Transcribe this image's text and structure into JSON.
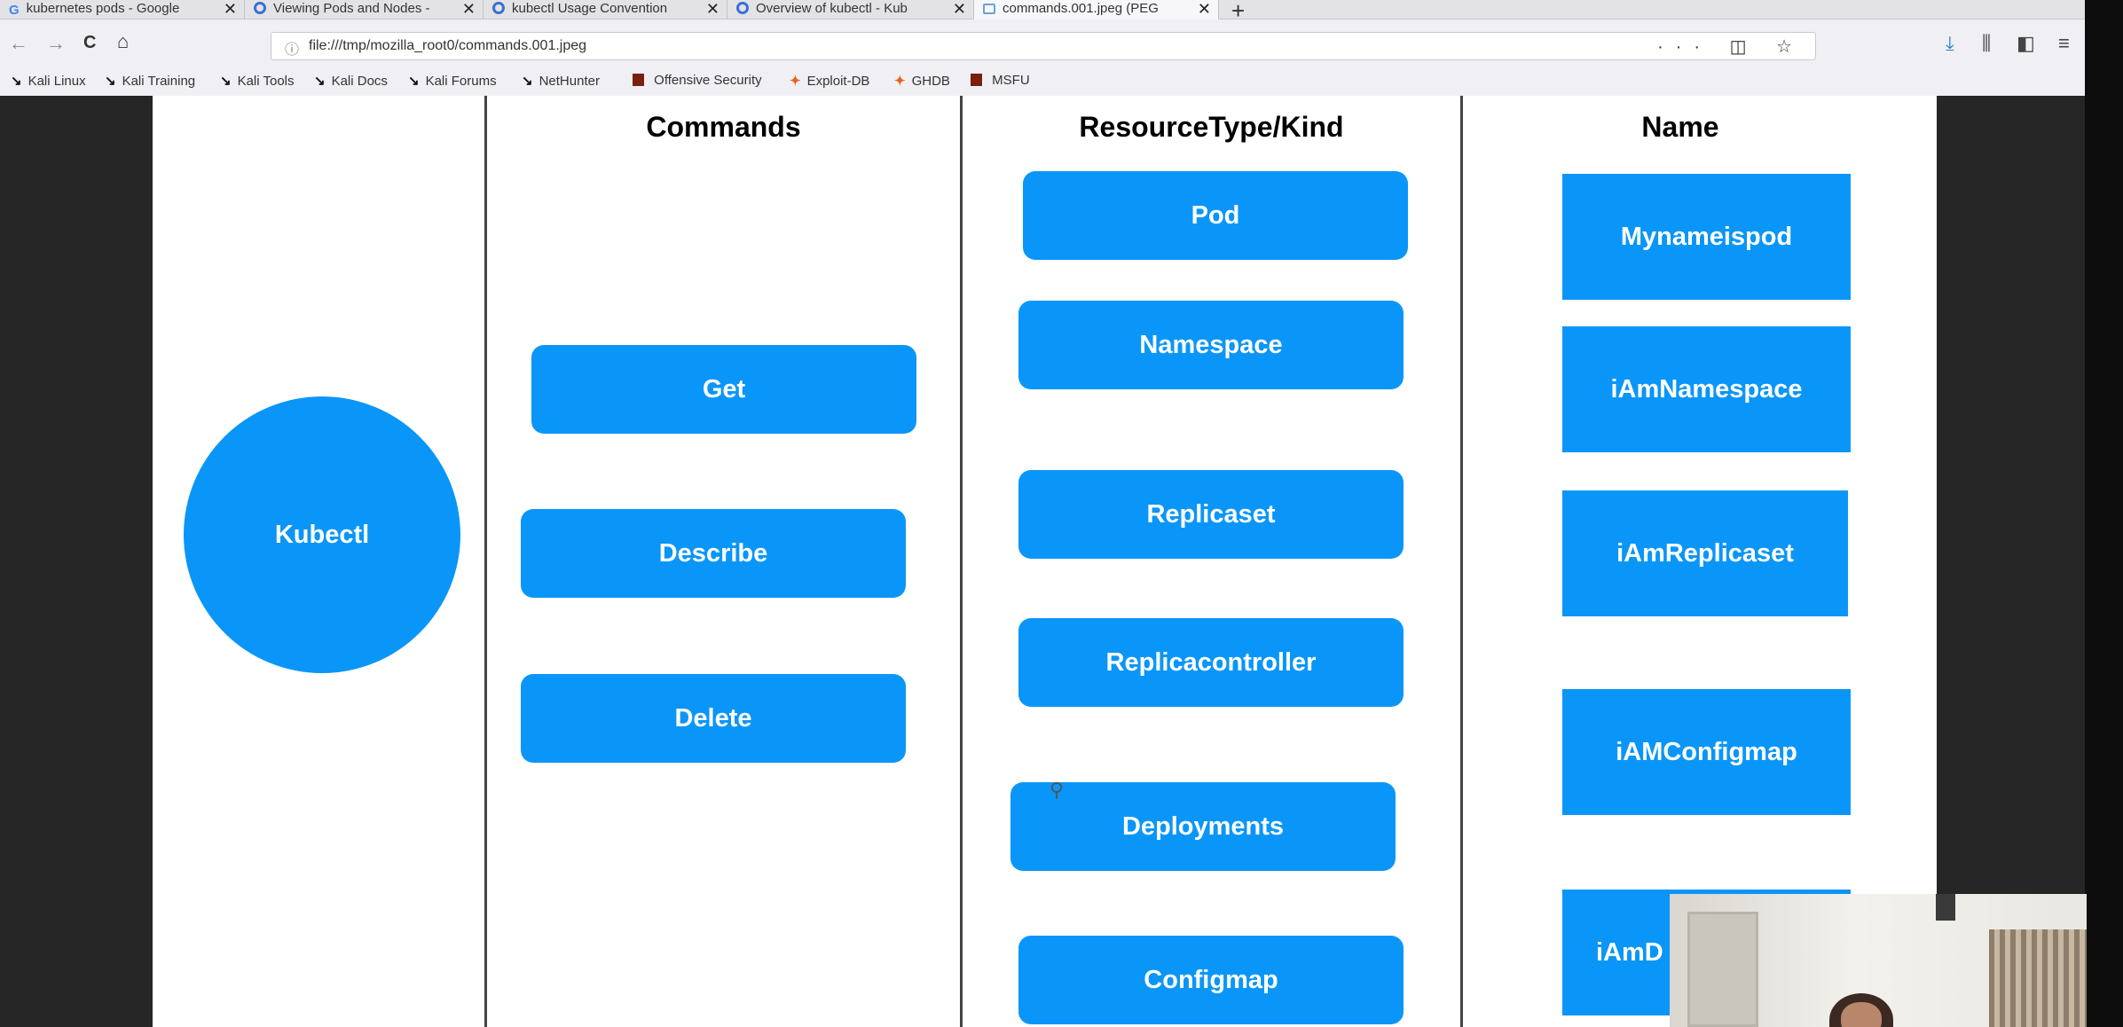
{
  "browser": {
    "tabs": [
      {
        "title": "kubernetes pods - Google",
        "icon": "google-icon"
      },
      {
        "title": "Viewing Pods and Nodes -",
        "icon": "kubernetes-icon"
      },
      {
        "title": "kubectl Usage Convention",
        "icon": "kubernetes-icon"
      },
      {
        "title": "Overview of kubectl - Kub",
        "icon": "kubernetes-icon"
      },
      {
        "title": "commands.001.jpeg (PEG",
        "icon": "image-icon"
      }
    ],
    "close_glyph": "✕",
    "new_tab_glyph": "+",
    "url_info_glyph": "ⓘ",
    "url": "file:///tmp/mozilla_root0/commands.001.jpeg",
    "url_actions": "··· ◫ ☆",
    "nav": {
      "back": "←",
      "forward": "→",
      "reload": "C",
      "home": "⌂"
    },
    "tools": {
      "download": "⤓",
      "library": "⫼",
      "sidebar": "◧",
      "menu": "≡"
    },
    "bookmarks": [
      {
        "label": "Kali Linux",
        "icon": "kali-dragon-icon"
      },
      {
        "label": "Kali Training",
        "icon": "kali-dragon-icon"
      },
      {
        "label": "Kali Tools",
        "icon": "kali-dragon-icon"
      },
      {
        "label": "Kali Docs",
        "icon": "kali-dragon-icon"
      },
      {
        "label": "Kali Forums",
        "icon": "kali-dragon-icon"
      },
      {
        "label": "NetHunter",
        "icon": "kali-dragon-icon"
      },
      {
        "label": "Offensive Security",
        "icon": "offsec-icon"
      },
      {
        "label": "Exploit-DB",
        "icon": "exploit-db-icon"
      },
      {
        "label": "GHDB",
        "icon": "ghdb-icon"
      },
      {
        "label": "MSFU",
        "icon": "msfu-icon"
      }
    ]
  },
  "slide": {
    "headers": {
      "commands": "Commands",
      "resource": "ResourceType/Kind",
      "name": "Name"
    },
    "kubectl": "Kubectl",
    "commands": [
      "Get",
      "Describe",
      "Delete"
    ],
    "resources": [
      "Pod",
      "Namespace",
      "Replicaset",
      "Replicacontroller",
      "Deployments",
      "Configmap"
    ],
    "names": [
      "Mynameispod",
      "iAmNamespace",
      "iAmReplicaset",
      "iAMConfigmap",
      "iAmD"
    ],
    "box_color": "#0a96f8"
  },
  "cursor_glyph": "⚲"
}
